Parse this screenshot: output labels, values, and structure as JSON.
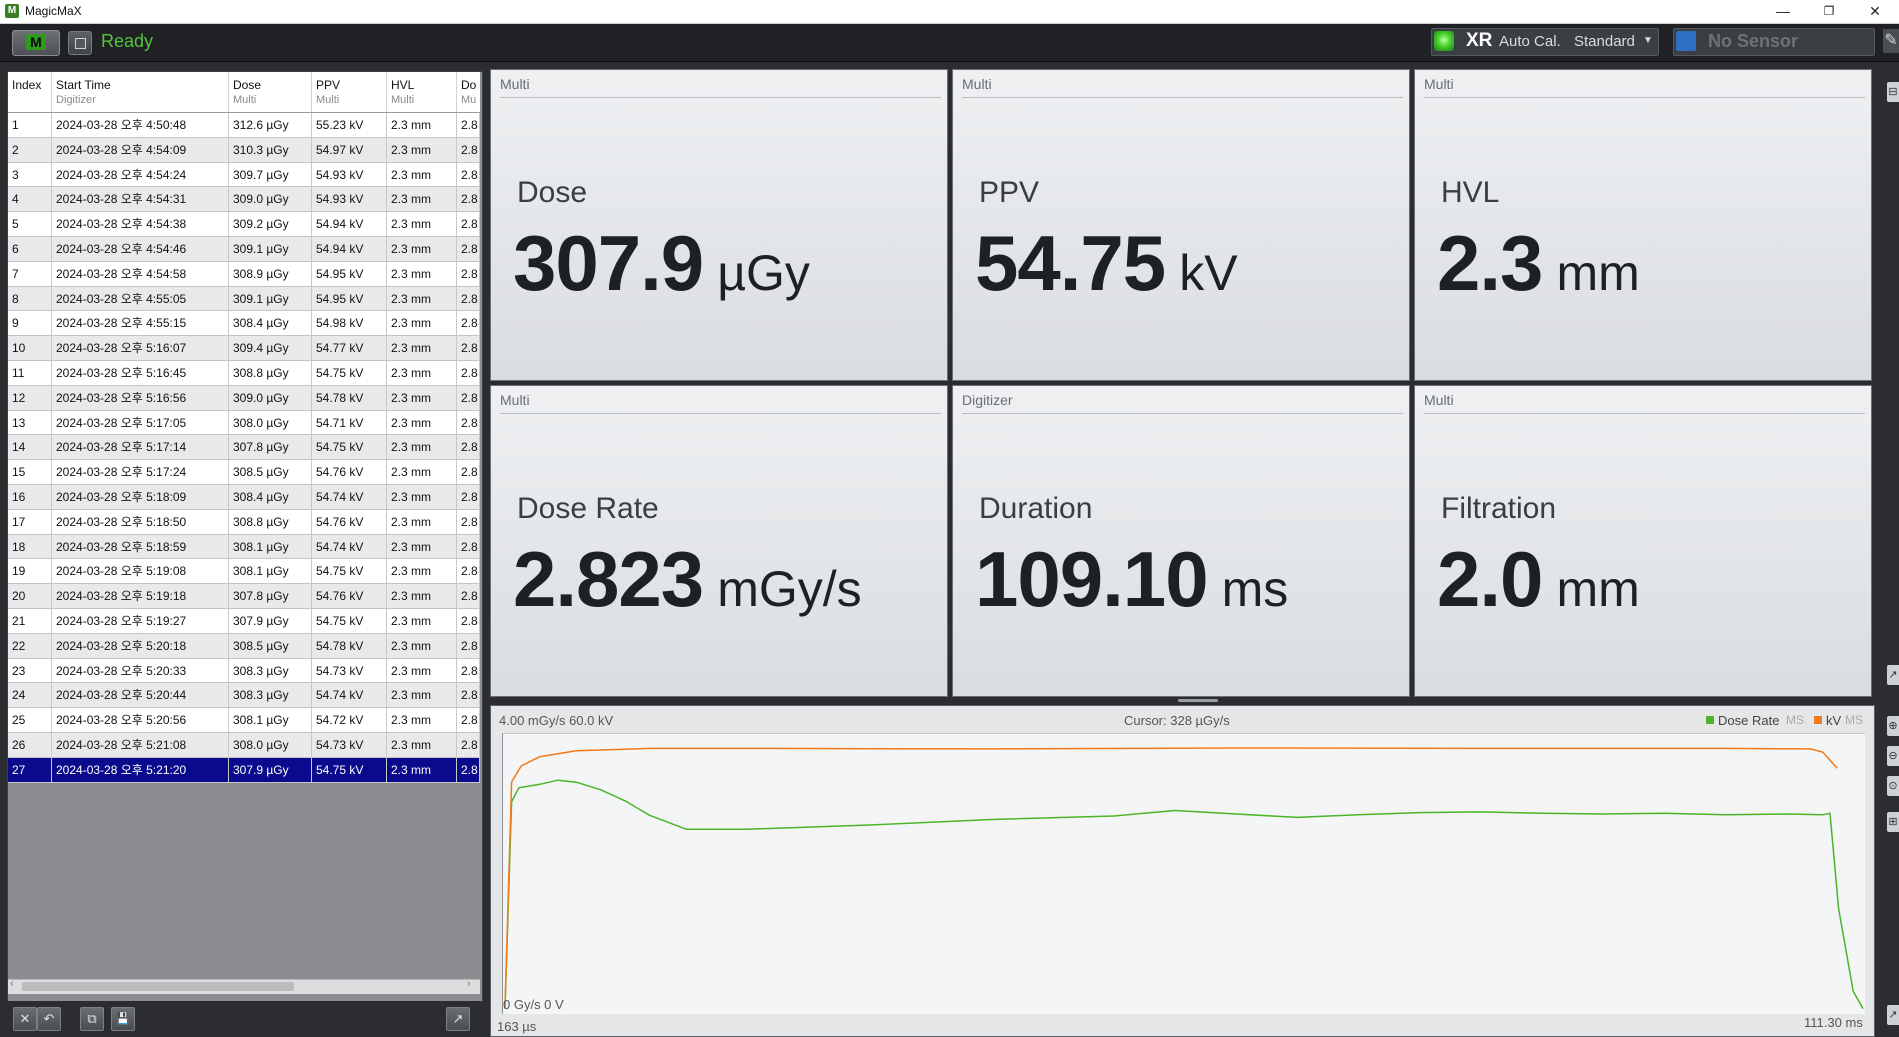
{
  "window": {
    "title": "MagicMaX",
    "app_icon": "M",
    "minimize": "—",
    "restore": "❐",
    "close": "✕"
  },
  "toolbar": {
    "mode_button": "M",
    "status": "Ready",
    "status_color": "#55c43d",
    "modality": "XR",
    "auto_cal": "Auto Cal.",
    "calibration": "Standard",
    "sensor": "No Sensor"
  },
  "table": {
    "columns": [
      {
        "title": "Index",
        "sub": ""
      },
      {
        "title": "Start Time",
        "sub": "Digitizer"
      },
      {
        "title": "Dose",
        "sub": "Multi"
      },
      {
        "title": "PPV",
        "sub": "Multi"
      },
      {
        "title": "HVL",
        "sub": "Multi"
      },
      {
        "title": "Do",
        "sub": "Mu"
      }
    ],
    "rows": [
      [
        "1",
        "2024-03-28 오후 4:50:48",
        "312.6 µGy",
        "55.23 kV",
        "2.3 mm",
        "2.8"
      ],
      [
        "2",
        "2024-03-28 오후 4:54:09",
        "310.3 µGy",
        "54.97 kV",
        "2.3 mm",
        "2.8"
      ],
      [
        "3",
        "2024-03-28 오후 4:54:24",
        "309.7 µGy",
        "54.93 kV",
        "2.3 mm",
        "2.8"
      ],
      [
        "4",
        "2024-03-28 오후 4:54:31",
        "309.0 µGy",
        "54.93 kV",
        "2.3 mm",
        "2.8"
      ],
      [
        "5",
        "2024-03-28 오후 4:54:38",
        "309.2 µGy",
        "54.94 kV",
        "2.3 mm",
        "2.8"
      ],
      [
        "6",
        "2024-03-28 오후 4:54:46",
        "309.1 µGy",
        "54.94 kV",
        "2.3 mm",
        "2.8"
      ],
      [
        "7",
        "2024-03-28 오후 4:54:58",
        "308.9 µGy",
        "54.95 kV",
        "2.3 mm",
        "2.8"
      ],
      [
        "8",
        "2024-03-28 오후 4:55:05",
        "309.1 µGy",
        "54.95 kV",
        "2.3 mm",
        "2.8"
      ],
      [
        "9",
        "2024-03-28 오후 4:55:15",
        "308.4 µGy",
        "54.98 kV",
        "2.3 mm",
        "2.8"
      ],
      [
        "10",
        "2024-03-28 오후 5:16:07",
        "309.4 µGy",
        "54.77 kV",
        "2.3 mm",
        "2.8"
      ],
      [
        "11",
        "2024-03-28 오후 5:16:45",
        "308.8 µGy",
        "54.75 kV",
        "2.3 mm",
        "2.8"
      ],
      [
        "12",
        "2024-03-28 오후 5:16:56",
        "309.0 µGy",
        "54.78 kV",
        "2.3 mm",
        "2.8"
      ],
      [
        "13",
        "2024-03-28 오후 5:17:05",
        "308.0 µGy",
        "54.71 kV",
        "2.3 mm",
        "2.8"
      ],
      [
        "14",
        "2024-03-28 오후 5:17:14",
        "307.8 µGy",
        "54.75 kV",
        "2.3 mm",
        "2.8"
      ],
      [
        "15",
        "2024-03-28 오후 5:17:24",
        "308.5 µGy",
        "54.76 kV",
        "2.3 mm",
        "2.8"
      ],
      [
        "16",
        "2024-03-28 오후 5:18:09",
        "308.4 µGy",
        "54.74 kV",
        "2.3 mm",
        "2.8"
      ],
      [
        "17",
        "2024-03-28 오후 5:18:50",
        "308.8 µGy",
        "54.76 kV",
        "2.3 mm",
        "2.8"
      ],
      [
        "18",
        "2024-03-28 오후 5:18:59",
        "308.1 µGy",
        "54.74 kV",
        "2.3 mm",
        "2.8"
      ],
      [
        "19",
        "2024-03-28 오후 5:19:08",
        "308.1 µGy",
        "54.75 kV",
        "2.3 mm",
        "2.8"
      ],
      [
        "20",
        "2024-03-28 오후 5:19:18",
        "307.8 µGy",
        "54.76 kV",
        "2.3 mm",
        "2.8"
      ],
      [
        "21",
        "2024-03-28 오후 5:19:27",
        "307.9 µGy",
        "54.75 kV",
        "2.3 mm",
        "2.8"
      ],
      [
        "22",
        "2024-03-28 오후 5:20:18",
        "308.5 µGy",
        "54.78 kV",
        "2.3 mm",
        "2.8"
      ],
      [
        "23",
        "2024-03-28 오후 5:20:33",
        "308.3 µGy",
        "54.73 kV",
        "2.3 mm",
        "2.8"
      ],
      [
        "24",
        "2024-03-28 오후 5:20:44",
        "308.3 µGy",
        "54.74 kV",
        "2.3 mm",
        "2.8"
      ],
      [
        "25",
        "2024-03-28 오후 5:20:56",
        "308.1 µGy",
        "54.72 kV",
        "2.3 mm",
        "2.8"
      ],
      [
        "26",
        "2024-03-28 오후 5:21:08",
        "308.0 µGy",
        "54.73 kV",
        "2.3 mm",
        "2.8"
      ],
      [
        "27",
        "2024-03-28 오후 5:21:20",
        "307.9 µGy",
        "54.75 kV",
        "2.3 mm",
        "2.8"
      ]
    ],
    "selected_index": 26,
    "scroll_left_arrow": "‹",
    "scroll_right_arrow": "›"
  },
  "table_actions": {
    "delete_icon": "✕",
    "undo_icon": "↶",
    "copy_icon": "⧉",
    "save_icon": "💾",
    "popout_icon": "↗"
  },
  "metrics": [
    {
      "source": "Multi",
      "label": "Dose",
      "value": "307.9",
      "unit": "µGy"
    },
    {
      "source": "Multi",
      "label": "PPV",
      "value": "54.75",
      "unit": "kV"
    },
    {
      "source": "Multi",
      "label": "HVL",
      "value": "2.3",
      "unit": "mm"
    },
    {
      "source": "Multi",
      "label": "Dose Rate",
      "value": "2.823",
      "unit": "mGy/s"
    },
    {
      "source": "Digitizer",
      "label": "Duration",
      "value": "109.10",
      "unit": "ms"
    },
    {
      "source": "Multi",
      "label": "Filtration",
      "value": "2.0",
      "unit": "mm"
    }
  ],
  "chart": {
    "ymax_label": "4.00 mGy/s   60.0 kV",
    "cursor": "Cursor: 328 µGy/s",
    "legend_dose": "Dose Rate",
    "legend_kv": "kV",
    "legend_ms": "MS",
    "ymin_label": "0 Gy/s   0 V",
    "xmin_label": "163 µs",
    "xmax_label": "111.30 ms",
    "dose_color": "#4ab52a",
    "kv_color": "#f07a1b"
  },
  "chart_data": {
    "type": "line",
    "xlabel": "",
    "ylabel": "",
    "xlim": [
      0.163,
      111.3
    ],
    "series": [
      {
        "name": "Dose Rate",
        "unit": "mGy/s",
        "ylim": [
          0,
          4.0
        ],
        "x": [
          0.163,
          0.7,
          1.3,
          3.0,
          4.5,
          6.0,
          8.0,
          10.0,
          12.0,
          15.0,
          20.0,
          30.0,
          40.0,
          50.0,
          55.0,
          60.0,
          65.0,
          70.0,
          75.0,
          80.0,
          85.0,
          90.0,
          95.0,
          100.0,
          105.0,
          108.0,
          108.6,
          109.3,
          110.5,
          111.3
        ],
        "values": [
          0.05,
          3.05,
          3.25,
          3.3,
          3.36,
          3.33,
          3.22,
          3.06,
          2.85,
          2.65,
          2.65,
          2.71,
          2.79,
          2.84,
          2.92,
          2.87,
          2.82,
          2.86,
          2.89,
          2.9,
          2.88,
          2.87,
          2.88,
          2.86,
          2.87,
          2.86,
          2.88,
          1.5,
          0.3,
          0.05
        ]
      },
      {
        "name": "kV",
        "unit": "kV",
        "ylim": [
          0,
          60.0
        ],
        "x": [
          0.163,
          0.7,
          1.5,
          3.0,
          6.0,
          12.0,
          20.0,
          40.0,
          60.0,
          80.0,
          100.0,
          107.0,
          108.0,
          109.2
        ],
        "values": [
          1.0,
          50.0,
          53.5,
          55.5,
          56.8,
          57.3,
          57.3,
          57.2,
          57.4,
          57.3,
          57.3,
          57.2,
          56.5,
          53.0
        ]
      }
    ]
  },
  "right_strip": {
    "b1": "⊟",
    "b2": "↗",
    "b3": "⊕",
    "b4": "⊖",
    "b5": "⊙",
    "b6": "⊞",
    "b7": "↗"
  }
}
